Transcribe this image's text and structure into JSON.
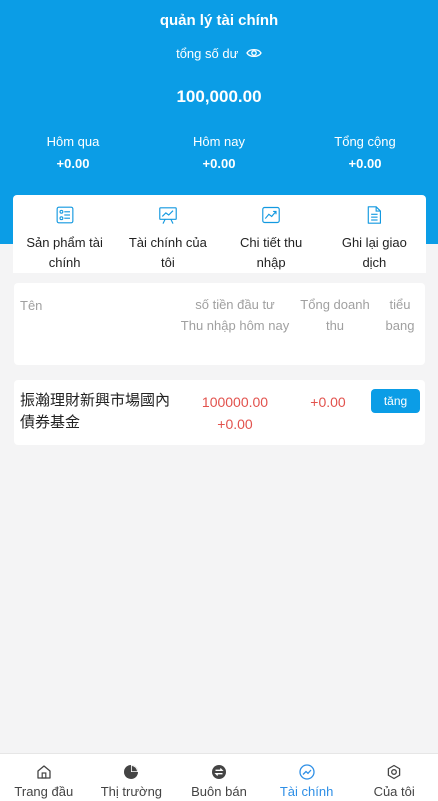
{
  "header": {
    "title": "quản lý tài chính",
    "balance_label": "tổng số dư",
    "balance_value": "100,000.00",
    "stats": [
      {
        "label": "Hôm qua",
        "value": "+0.00"
      },
      {
        "label": "Hôm nay",
        "value": "+0.00"
      },
      {
        "label": "Tổng cộng",
        "value": "+0.00"
      }
    ]
  },
  "menu": [
    {
      "label": "Sản phẩm tài chính",
      "icon": "product-list-icon"
    },
    {
      "label": "Tài chính của tôi",
      "icon": "chart-board-icon"
    },
    {
      "label": "Chi tiết thu nhập",
      "icon": "trend-chart-icon"
    },
    {
      "label": "Ghi lại giao dịch",
      "icon": "document-icon"
    }
  ],
  "table": {
    "headers": {
      "name": "Tên",
      "invest_line1": "số tiền đầu tư",
      "invest_line2": "Thu nhập hôm nay",
      "revenue": "Tổng doanh thu",
      "action": "tiểu bang"
    },
    "rows": [
      {
        "name": "振瀚理財新興市場國內債券基金",
        "invest": "100000.00",
        "today_income": "+0.00",
        "revenue": "+0.00",
        "action_label": "tăng"
      }
    ]
  },
  "tabbar": {
    "active_index": 3,
    "tabs": [
      {
        "label": "Trang đầu",
        "icon": "home-icon"
      },
      {
        "label": "Thị trường",
        "icon": "pie-chart-icon"
      },
      {
        "label": "Buôn bán",
        "icon": "exchange-icon"
      },
      {
        "label": "Tài chính",
        "icon": "finance-trend-icon"
      },
      {
        "label": "Của tôi",
        "icon": "settings-icon"
      }
    ]
  },
  "colors": {
    "primary": "#0b9de6",
    "positive_value": "#e2524d",
    "active_tab": "#2e8fe6",
    "background": "#f4f4f5"
  }
}
